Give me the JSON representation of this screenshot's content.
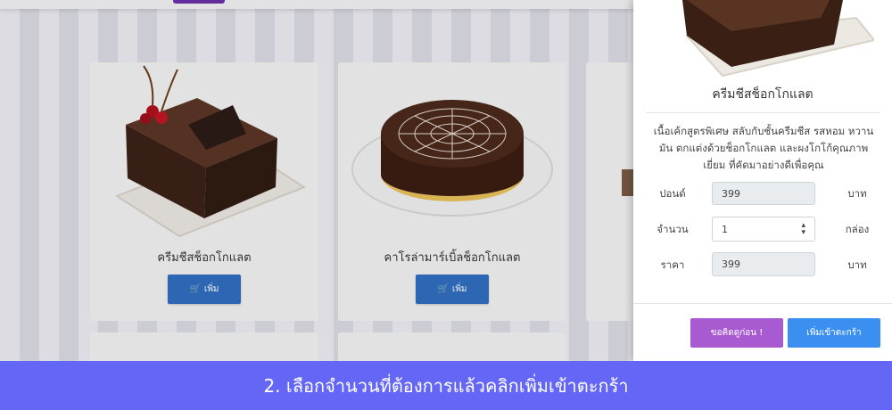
{
  "products": [
    {
      "name": "ครีมชีสช็อกโกแลต",
      "button_label": "เพิ่ม"
    },
    {
      "name": "คาโรล่ามาร์เบิ้ลช็อกโกแลต",
      "button_label": "เพิ่ม"
    }
  ],
  "detail": {
    "title": "ครีมชีสช็อกโกแลต",
    "description": "เนื้อเค้กสูตรพิเศษ สลับกับชั้นครีมชีส รสหอม หวานมัน ตกแต่งด้วยช็อกโกแลต และผงโกโก้คุณภาพเยี่ยม ที่คัดมาอย่างดีเพื่อคุณ",
    "pound_label": "ปอนด์",
    "pound_value": "399",
    "pound_unit": "บาท",
    "qty_label": "จำนวน",
    "qty_value": "1",
    "qty_unit": "กล่อง",
    "price_label": "ราคา",
    "price_value": "399",
    "price_unit": "บาท",
    "ask_button": "ขอคิดดูก่อน !",
    "cart_button": "เพิ่มเข้าตะกร้า"
  },
  "caption": "2. เลือกจำนวนที่ต้องการแล้วคลิกเพิ่มเข้าตะกร้า",
  "colors": {
    "caption_bg": "#6466f5",
    "add_button": "#2f6ec0",
    "ask_button": "#a85bd1",
    "cart_button": "#3b8ff0"
  }
}
